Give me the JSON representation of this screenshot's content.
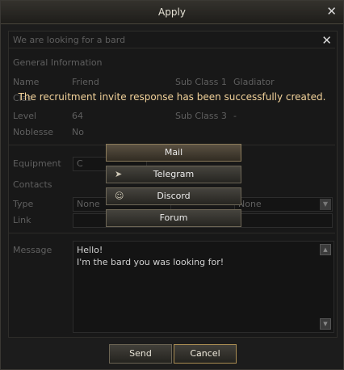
{
  "window": {
    "title": "Apply",
    "close_glyph": "✕"
  },
  "panel": {
    "heading": "We are looking for a bard",
    "close_glyph": "✕",
    "general_title": "General Information",
    "rows": [
      {
        "label": "Name",
        "value": "Friend",
        "label2": "Sub Class 1",
        "value2": "Gladiator"
      },
      {
        "label": "Clas",
        "value": "",
        "label2": "",
        "value2": ""
      },
      {
        "label": "Level",
        "value": "64",
        "label2": "Sub Class 3",
        "value2": "-"
      },
      {
        "label": "Noblesse",
        "value": "No",
        "label2": "",
        "value2": ""
      }
    ],
    "equipment_label": "Equipment",
    "equipment_value": "C",
    "contacts_title": "Contacts",
    "type_label": "Type",
    "type_value": "None",
    "type_value2": "None",
    "link_label": "Link",
    "message_label": "Message",
    "message_lines": [
      "Hello!",
      "I'm the bard you was looking for!"
    ]
  },
  "notice": "The recruitment invite response has been successfully created.",
  "share_menu": [
    {
      "label": "Mail",
      "icon": ""
    },
    {
      "label": "Telegram",
      "icon": "telegram-icon"
    },
    {
      "label": "Discord",
      "icon": "discord-icon"
    },
    {
      "label": "Forum",
      "icon": ""
    }
  ],
  "buttons": {
    "send": "Send",
    "cancel": "Cancel"
  }
}
